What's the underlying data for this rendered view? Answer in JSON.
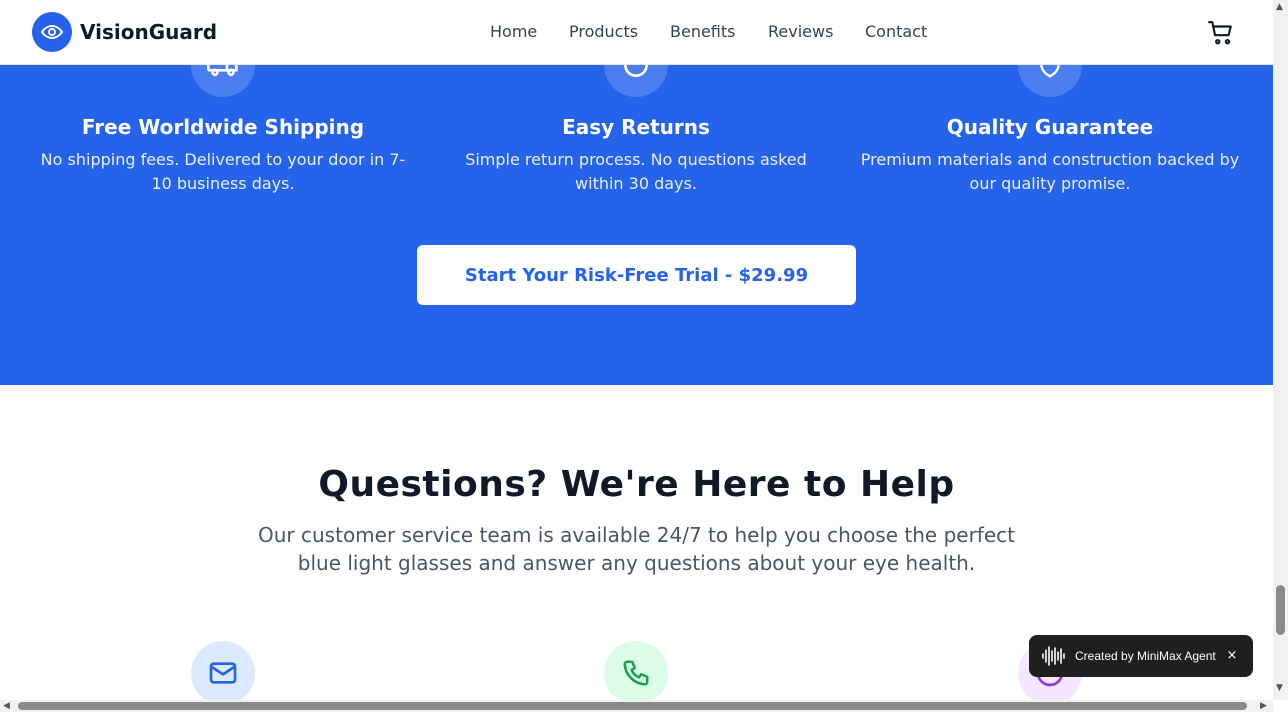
{
  "header": {
    "brand": "VisionGuard",
    "nav": [
      "Home",
      "Products",
      "Benefits",
      "Reviews",
      "Contact"
    ],
    "icons": {
      "logo": "eye-icon",
      "cart": "shopping-cart-icon"
    }
  },
  "guarantees": {
    "items": [
      {
        "icon": "truck-icon",
        "title": "Free Worldwide Shipping",
        "desc_line1": "No shipping fees. Delivered to your door in 7-",
        "desc_line2": "10 business days."
      },
      {
        "icon": "refresh-icon",
        "title": "Easy Returns",
        "desc_line1": "Simple return process. No questions asked",
        "desc_line2": "within 30 days."
      },
      {
        "icon": "shield-icon",
        "title": "Quality Guarantee",
        "desc_line1": "Premium materials and construction backed by",
        "desc_line2": "our quality promise."
      }
    ],
    "cta_label": "Start Your Risk-Free Trial - $29.99"
  },
  "help": {
    "title": "Questions? We're Here to Help",
    "subtitle": "Our customer service team is available 24/7 to help you choose the perfect blue light glasses and answer any questions about your eye health.",
    "contact_icons": [
      "mail-icon",
      "phone-icon",
      "chat-icon"
    ]
  },
  "toast": {
    "text": "Created by MiniMax Agent",
    "close": "×"
  },
  "colors": {
    "brand_blue": "#2563eb",
    "mail_bg": "#dbeafe",
    "phone_bg": "#dcfce7",
    "chat_bg": "#f3e8ff"
  }
}
